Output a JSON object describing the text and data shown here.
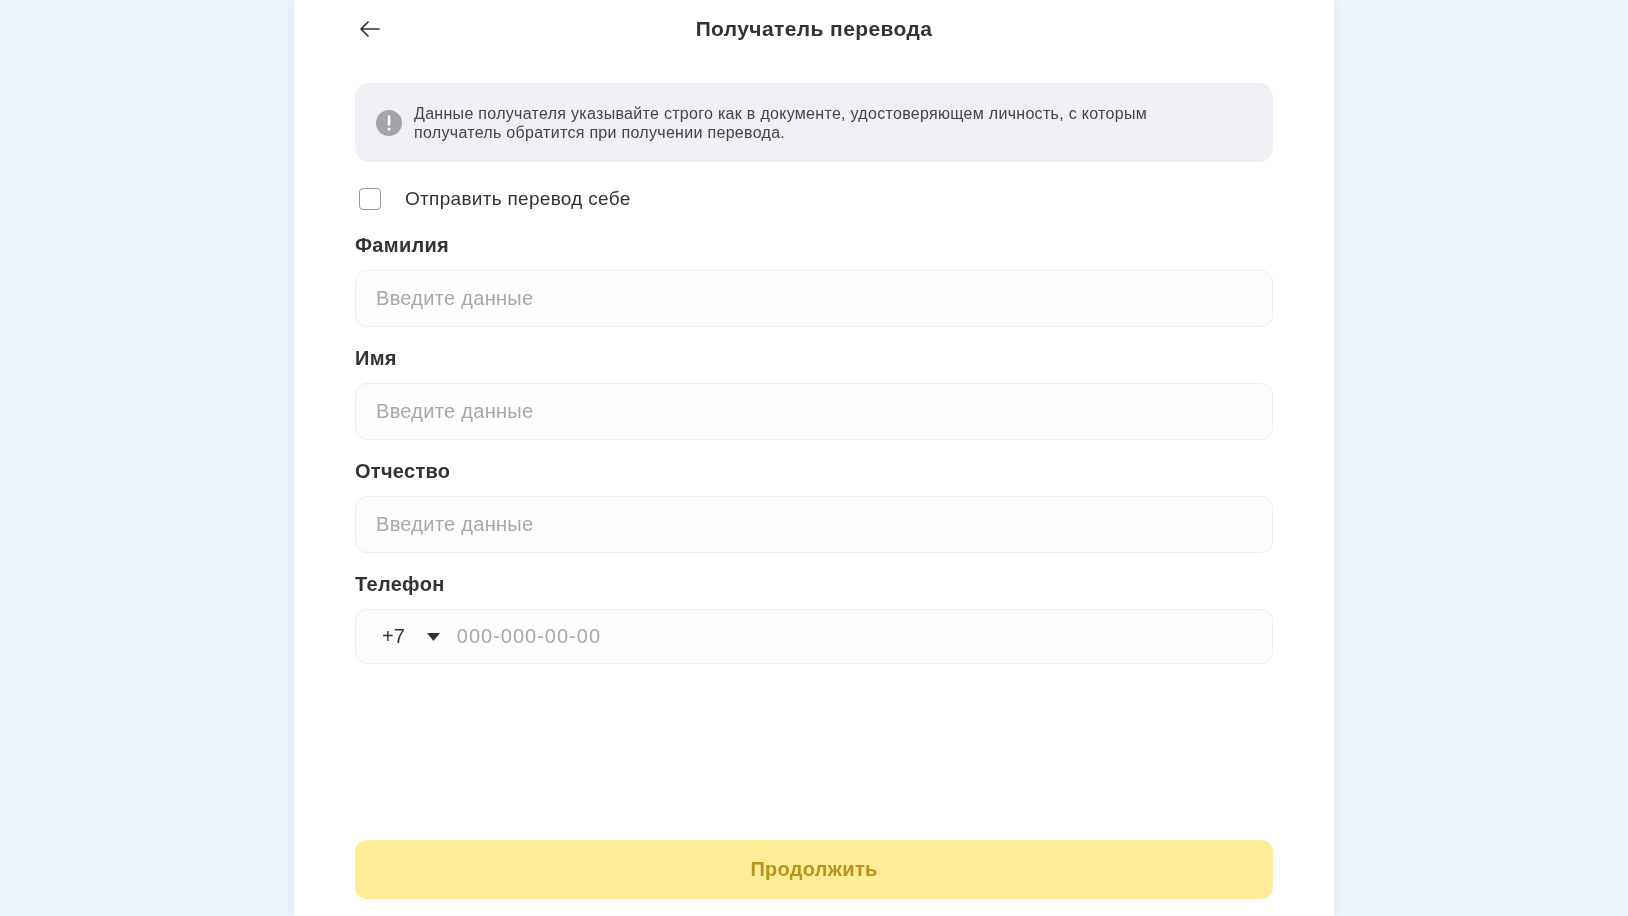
{
  "header": {
    "title": "Получатель перевода"
  },
  "notice": {
    "text": "Данные получателя указывайте строго как в документе, удостоверяющем личность, с которым получатель обратится при получении перевода."
  },
  "send_to_self": {
    "label": "Отправить перевод себе",
    "checked": false
  },
  "fields": [
    {
      "kind": "text",
      "label": "Фамилия",
      "placeholder": "Введите данные"
    },
    {
      "kind": "text",
      "label": "Имя",
      "placeholder": "Введите данные"
    },
    {
      "kind": "text",
      "label": "Отчество",
      "placeholder": "Введите данные"
    },
    {
      "kind": "phone",
      "label": "Телефон",
      "country_code": "+7",
      "placeholder": "000-000-00-00"
    }
  ],
  "continue_button": {
    "label": "Продолжить",
    "disabled": true
  }
}
